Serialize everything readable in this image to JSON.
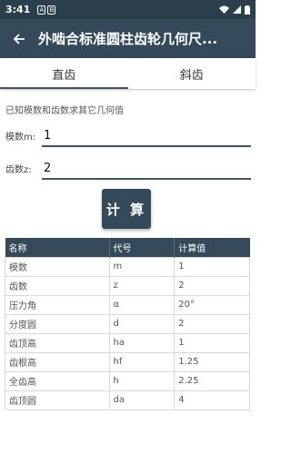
{
  "status": {
    "time": "3:41",
    "badge1": "A",
    "badge2": "B"
  },
  "appbar": {
    "back_icon": "arrow-left-icon",
    "title": "外啮合标准圆柱齿轮几何尺..."
  },
  "tabs": [
    {
      "label": "直齿",
      "active": true
    },
    {
      "label": "斜齿",
      "active": false
    }
  ],
  "hint": "已知模数和齿数求其它几何值",
  "form": {
    "module": {
      "label": "模数m:",
      "value": "1"
    },
    "teeth": {
      "label": "齿数z:",
      "value": "2"
    }
  },
  "calc_button": "计 算",
  "table": {
    "headers": [
      "名称",
      "代号",
      "计算值"
    ],
    "rows": [
      [
        "模数",
        "m",
        "1"
      ],
      [
        "齿数",
        "z",
        "2"
      ],
      [
        "压力角",
        "α",
        "20°"
      ],
      [
        "分度圆",
        "d",
        "2"
      ],
      [
        "齿顶高",
        "ha",
        "1"
      ],
      [
        "齿根高",
        "hf",
        "1.25"
      ],
      [
        "全齿高",
        "h",
        "2.25"
      ],
      [
        "齿顶圆",
        "da",
        "4"
      ]
    ]
  }
}
